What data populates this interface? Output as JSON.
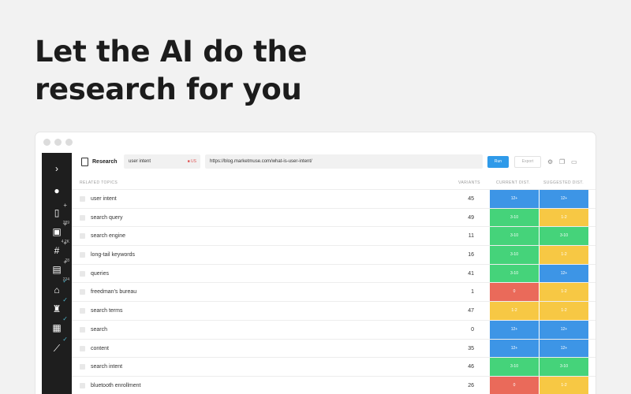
{
  "hero": {
    "line1": "Let the AI do the",
    "line2": "research for you"
  },
  "colors": {
    "blue": "#3d95e6",
    "green": "#45d37a",
    "yellow": "#f7c844",
    "red": "#ea6a5a"
  },
  "sidebar": {
    "items": [
      {
        "icon": "chevron-right-icon",
        "glyph": "›"
      },
      {
        "icon": "user-icon",
        "glyph": "●"
      },
      {
        "icon": "document-icon",
        "glyph": "▯",
        "count": "289"
      },
      {
        "icon": "calendar-icon",
        "glyph": "▣",
        "count": "4.2K"
      },
      {
        "icon": "hashtag-icon",
        "glyph": "#",
        "count": "28"
      },
      {
        "icon": "image-icon",
        "glyph": "▤",
        "count": "224"
      },
      {
        "icon": "users-icon",
        "glyph": "⌂"
      },
      {
        "icon": "trophy-icon",
        "glyph": "♜"
      },
      {
        "icon": "report-icon",
        "glyph": "▦"
      },
      {
        "icon": "link-icon",
        "glyph": "⟋"
      }
    ]
  },
  "toolbar": {
    "title": "Research",
    "keyword_value": "user intent",
    "keyword_badge": "■ US",
    "url_value": "https://blog.marketmuse.com/what-is-user-intent/",
    "run_label": "Run",
    "export_label": "Export"
  },
  "table": {
    "headers": {
      "topic": "RELATED TOPICS",
      "variants": "VARIANTS",
      "current": "CURRENT DIST.",
      "suggested": "SUGGESTED DIST."
    },
    "rows": [
      {
        "topic": "user intent",
        "variants": "45",
        "current": "12+",
        "current_color": "blue",
        "suggested": "12+",
        "suggested_color": "blue"
      },
      {
        "topic": "search query",
        "variants": "49",
        "current": "3-10",
        "current_color": "green",
        "suggested": "1-2",
        "suggested_color": "yellow"
      },
      {
        "topic": "search engine",
        "variants": "11",
        "current": "3-10",
        "current_color": "green",
        "suggested": "3-10",
        "suggested_color": "green"
      },
      {
        "topic": "long-tail keywords",
        "variants": "16",
        "current": "3-10",
        "current_color": "green",
        "suggested": "1-2",
        "suggested_color": "yellow"
      },
      {
        "topic": "queries",
        "variants": "41",
        "current": "3-10",
        "current_color": "green",
        "suggested": "12+",
        "suggested_color": "blue"
      },
      {
        "topic": "freedman's bureau",
        "variants": "1",
        "current": "0",
        "current_color": "red",
        "suggested": "1-2",
        "suggested_color": "yellow"
      },
      {
        "topic": "search terms",
        "variants": "47",
        "current": "1-2",
        "current_color": "yellow",
        "suggested": "1-2",
        "suggested_color": "yellow"
      },
      {
        "topic": "search",
        "variants": "0",
        "current": "12+",
        "current_color": "blue",
        "suggested": "12+",
        "suggested_color": "blue"
      },
      {
        "topic": "content",
        "variants": "35",
        "current": "12+",
        "current_color": "blue",
        "suggested": "12+",
        "suggested_color": "blue"
      },
      {
        "topic": "search intent",
        "variants": "46",
        "current": "3-10",
        "current_color": "green",
        "suggested": "3-10",
        "suggested_color": "green"
      },
      {
        "topic": "bluetooth enrollment",
        "variants": "26",
        "current": "0",
        "current_color": "red",
        "suggested": "1-2",
        "suggested_color": "yellow"
      }
    ]
  }
}
